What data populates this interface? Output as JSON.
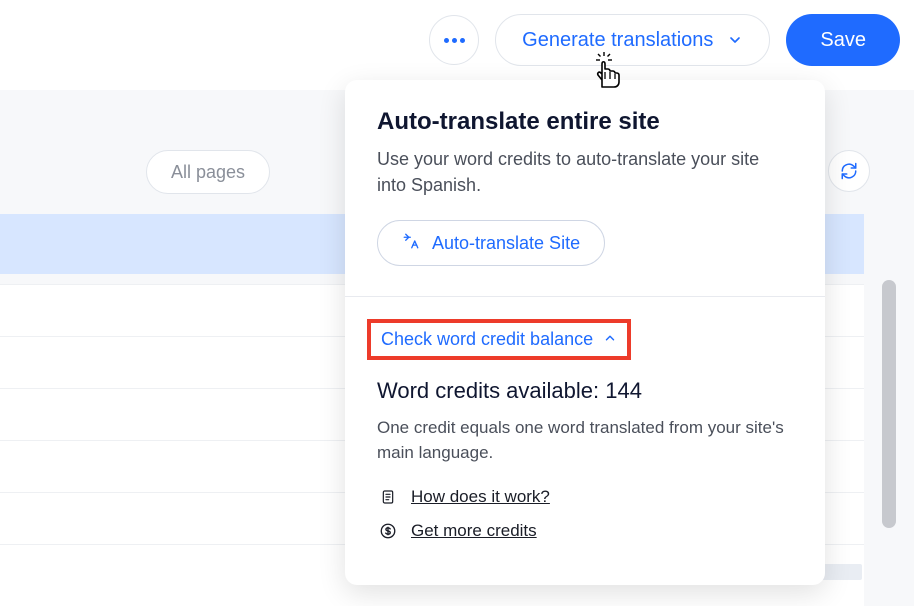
{
  "toolbar": {
    "generate_label": "Generate translations",
    "save_label": "Save"
  },
  "filter": {
    "all_pages_label": "All pages"
  },
  "dropdown": {
    "title": "Auto-translate entire site",
    "description": "Use your word credits to auto-translate your site into Spanish.",
    "auto_translate_label": "Auto-translate Site",
    "credit_toggle_label": "Check word credit balance",
    "credits_available_prefix": "Word credits available: ",
    "credits_available_value": "144",
    "credits_description": "One credit equals one word translated from your site's main language.",
    "how_link": "How does it work?",
    "get_more_link": "Get more credits"
  }
}
